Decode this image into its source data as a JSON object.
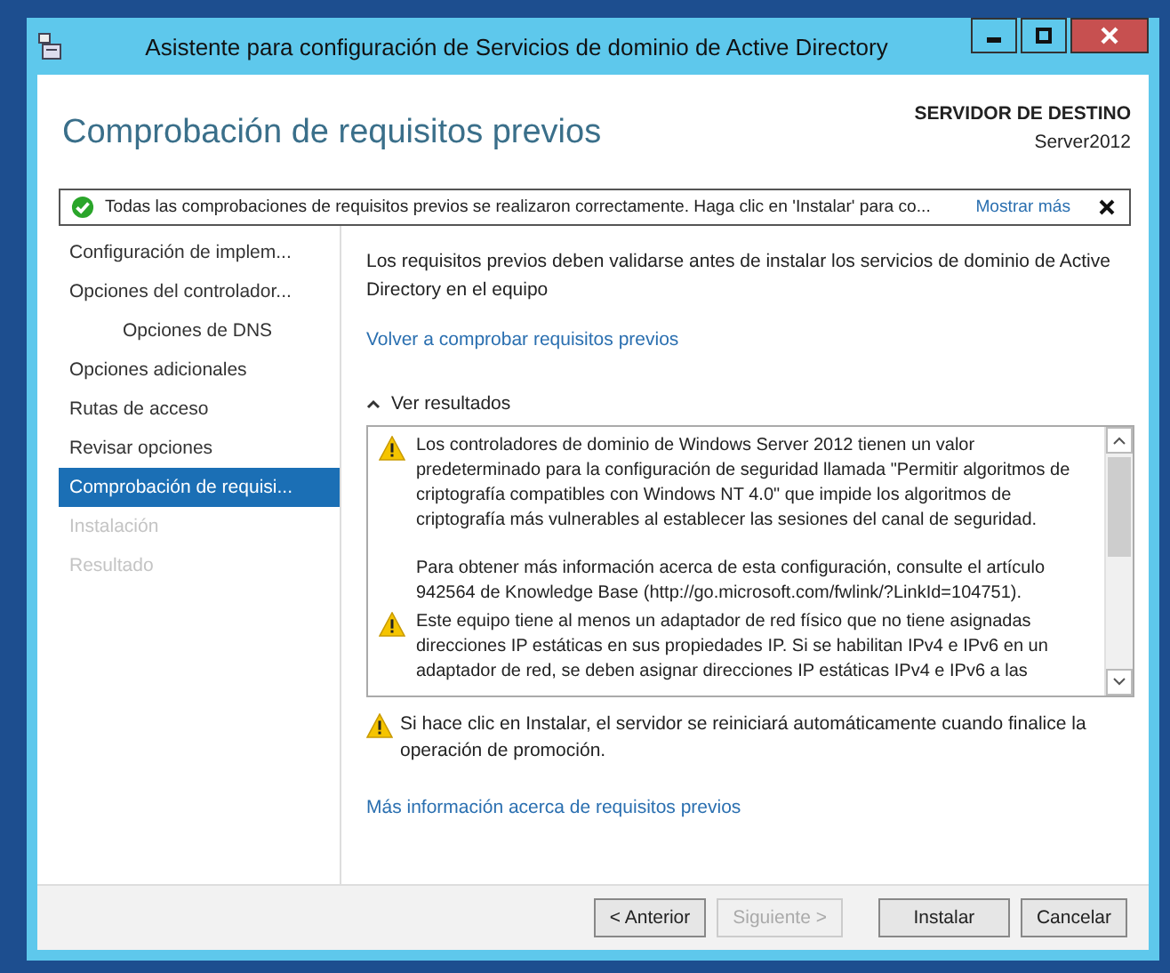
{
  "window": {
    "title": "Asistente para configuración de Servicios de dominio de Active Directory"
  },
  "header": {
    "title": "Comprobación de requisitos previos",
    "target_label": "SERVIDOR DE DESTINO",
    "target_server": "Server2012"
  },
  "notification": {
    "text": "Todas las comprobaciones de requisitos previos se realizaron correctamente. Haga clic en 'Instalar' para co...",
    "link": "Mostrar más"
  },
  "sidebar": {
    "items": [
      {
        "label": "Configuración de implem...",
        "selected": false,
        "disabled": false
      },
      {
        "label": "Opciones del controlador...",
        "selected": false,
        "disabled": false,
        "children": [
          {
            "label": "Opciones de DNS",
            "selected": false,
            "disabled": false
          }
        ]
      },
      {
        "label": "Opciones adicionales",
        "selected": false,
        "disabled": false
      },
      {
        "label": "Rutas de acceso",
        "selected": false,
        "disabled": false
      },
      {
        "label": "Revisar opciones",
        "selected": false,
        "disabled": false
      },
      {
        "label": "Comprobación de requisi...",
        "selected": true,
        "disabled": false
      },
      {
        "label": "Instalación",
        "selected": false,
        "disabled": true
      },
      {
        "label": "Resultado",
        "selected": false,
        "disabled": true
      }
    ]
  },
  "content": {
    "intro": "Los requisitos previos deben validarse antes de instalar los servicios de dominio de Active Directory en el equipo",
    "recheck_link": "Volver a comprobar requisitos previos",
    "results_toggle": {
      "label": "Ver resultados",
      "expanded": true
    },
    "results": [
      {
        "kind": "warning",
        "text": "Los controladores de dominio de Windows Server 2012 tienen un valor predeterminado para la configuración de seguridad llamada \"Permitir algoritmos de criptografía compatibles con Windows NT 4.0\" que impide los algoritmos de criptografía más vulnerables al establecer las sesiones del canal de seguridad."
      },
      {
        "kind": "paragraph",
        "text": "Para obtener más información acerca de esta configuración, consulte el artículo 942564 de Knowledge Base (http://go.microsoft.com/fwlink/?LinkId=104751)."
      },
      {
        "kind": "warning",
        "text": "Este equipo tiene al menos un adaptador de red físico que no tiene asignadas direcciones IP estáticas en sus propiedades IP. Si se habilitan IPv4 e IPv6 en un adaptador de red, se deben asignar direcciones IP estáticas IPv4 e IPv6 a las"
      }
    ],
    "restart_warning": "Si hace clic en Instalar, el servidor se reiniciará automáticamente cuando finalice la operación de promoción.",
    "more_info_link": "Más información acerca de requisitos previos"
  },
  "buttons": [
    {
      "label": "< Anterior",
      "disabled": false
    },
    {
      "label": "Siguiente >",
      "disabled": true
    },
    {
      "label": "Instalar",
      "disabled": false
    },
    {
      "label": "Cancelar",
      "disabled": false
    }
  ]
}
